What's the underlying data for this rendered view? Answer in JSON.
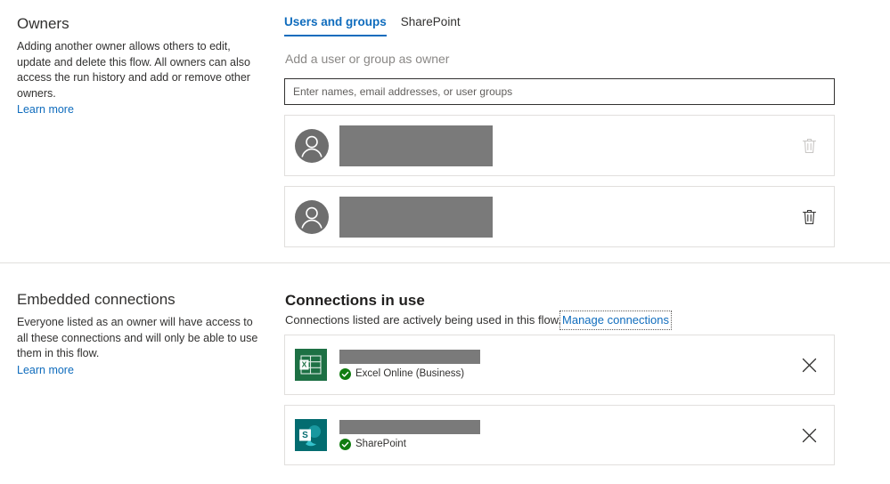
{
  "owners": {
    "side_title": "Owners",
    "side_desc": "Adding another owner allows others to edit, update and delete this flow. All owners can also access the run history and add or remove other owners.",
    "learn_more": "Learn more",
    "tabs": [
      {
        "label": "Users and groups",
        "active": true
      },
      {
        "label": "SharePoint",
        "active": false
      }
    ],
    "field_label": "Add a user or group as owner",
    "input_placeholder": "Enter names, email addresses, or user groups",
    "input_value": "",
    "rows": [
      {
        "name": "",
        "redacted": true,
        "delete_enabled": false
      },
      {
        "name": "",
        "redacted": true,
        "delete_enabled": true
      }
    ]
  },
  "connections": {
    "side_title": "Embedded connections",
    "side_desc": "Everyone listed as an owner will have access to all these connections and will only be able to use them in this flow.",
    "learn_more": "Learn more",
    "heading": "Connections in use",
    "subheading": "Connections listed are actively being used in this flow.",
    "manage_link": "Manage connections",
    "rows": [
      {
        "name": "Excel Online (Business)",
        "icon": "excel-icon",
        "status": "connected",
        "redacted": true
      },
      {
        "name": "SharePoint",
        "icon": "sharepoint-icon",
        "status": "connected",
        "redacted": true
      }
    ]
  },
  "colors": {
    "accent": "#0f6cbd",
    "excel_green": "#1d7044",
    "sharepoint_teal": "#036c70",
    "status_green": "#107c10",
    "redaction_gray": "#7a7a7a",
    "border": "#e1dfdd"
  }
}
